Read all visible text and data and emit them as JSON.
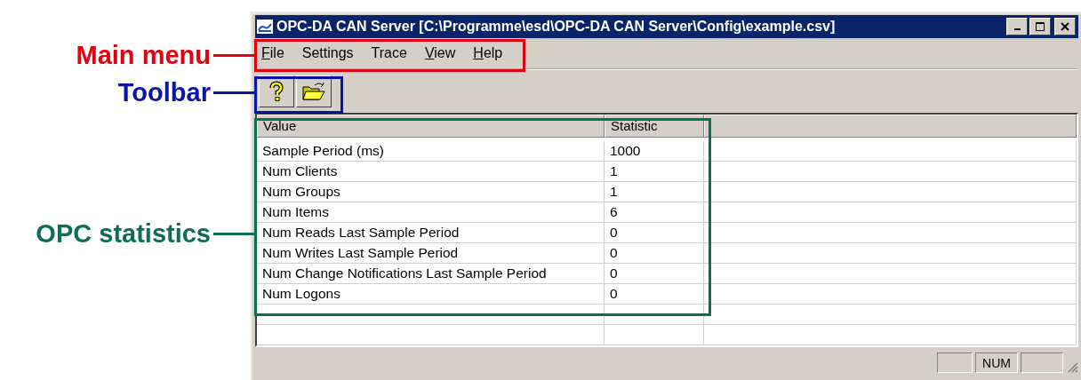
{
  "annotations": [
    {
      "label": "Main menu",
      "color": "#e3000f"
    },
    {
      "label": "Toolbar",
      "color": "#0a14a8"
    },
    {
      "label": "OPC statistics",
      "color": "#0e6e55"
    }
  ],
  "window": {
    "title": "OPC-DA CAN Server [C:\\Programme\\esd\\OPC-DA CAN Server\\Config\\example.csv]"
  },
  "menu": [
    {
      "label": "File",
      "underline_first": true
    },
    {
      "label": "Settings",
      "underline_first": false
    },
    {
      "label": "Trace",
      "underline_first": false
    },
    {
      "label": "View",
      "underline_first": true
    },
    {
      "label": "Help",
      "underline_first": true
    }
  ],
  "table": {
    "columns": [
      "Value",
      "Statistic"
    ],
    "rows": [
      {
        "value": "Sample Period (ms)",
        "statistic": "1000"
      },
      {
        "value": "Num Clients",
        "statistic": "1"
      },
      {
        "value": "Num Groups",
        "statistic": "1"
      },
      {
        "value": "Num Items",
        "statistic": "6"
      },
      {
        "value": "Num Reads Last Sample Period",
        "statistic": "0"
      },
      {
        "value": "Num Writes Last Sample Period",
        "statistic": "0"
      },
      {
        "value": "Num Change Notifications Last Sample Period",
        "statistic": "0"
      },
      {
        "value": "Num Logons",
        "statistic": "0"
      }
    ]
  },
  "status_bar": {
    "indicator": "NUM"
  }
}
